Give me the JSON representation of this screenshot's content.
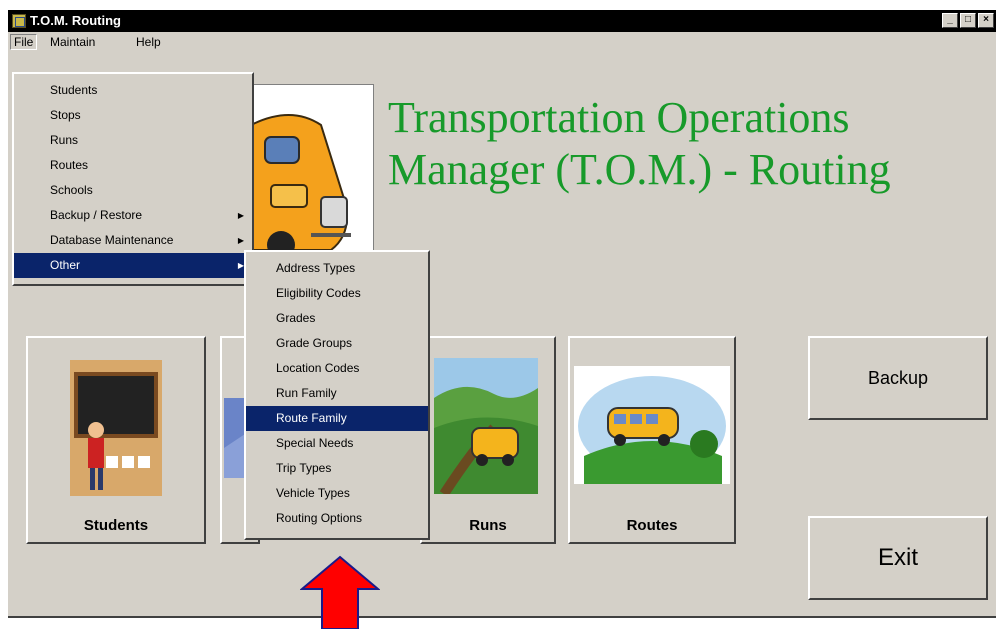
{
  "window": {
    "title": "T.O.M. Routing",
    "controls": [
      "_",
      "□",
      "×"
    ]
  },
  "menubar": {
    "items": [
      "File",
      "Maintain",
      "Help"
    ]
  },
  "banner": {
    "line1": "Transportation Operations",
    "line2": "Manager (T.O.M.) - Routing"
  },
  "file_menu": {
    "items": [
      {
        "label": "Students"
      },
      {
        "label": "Stops"
      },
      {
        "label": "Runs"
      },
      {
        "label": "Routes"
      },
      {
        "label": "Schools"
      },
      {
        "label": "Backup / Restore",
        "submenu": true
      },
      {
        "label": "Database Maintenance",
        "submenu": true
      },
      {
        "label": "Other",
        "submenu": true,
        "highlighted": true
      }
    ]
  },
  "other_submenu": {
    "items": [
      "Address Types",
      "Eligibility Codes",
      "Grades",
      "Grade Groups",
      "Location Codes",
      "Run Family",
      "Route Family",
      "Special Needs",
      "Trip Types",
      "Vehicle Types",
      "Routing Options"
    ],
    "highlighted": "Route Family"
  },
  "tiles": {
    "students": "Students",
    "runs": "Runs",
    "routes": "Routes"
  },
  "buttons": {
    "backup": "Backup",
    "exit": "Exit"
  },
  "colors": {
    "highlight": "#0a246a",
    "banner_text": "#179a2a",
    "arrow": "#ff0000"
  }
}
